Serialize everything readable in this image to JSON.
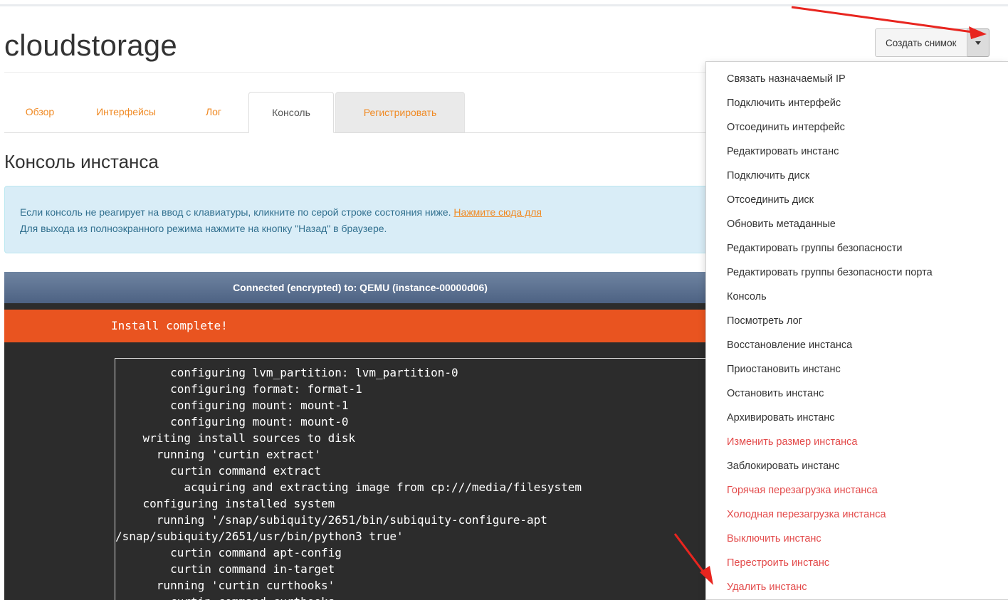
{
  "page": {
    "title": "cloudstorage"
  },
  "actions": {
    "primary_label": "Создать снимок",
    "menu": [
      {
        "label": "Связать назначаемый IP",
        "danger": false
      },
      {
        "label": "Подключить интерфейс",
        "danger": false
      },
      {
        "label": "Отсоединить интерфейс",
        "danger": false
      },
      {
        "label": "Редактировать инстанс",
        "danger": false
      },
      {
        "label": "Подключить диск",
        "danger": false
      },
      {
        "label": "Отсоединить диск",
        "danger": false
      },
      {
        "label": "Обновить метаданные",
        "danger": false
      },
      {
        "label": "Редактировать группы безопасности",
        "danger": false
      },
      {
        "label": "Редактировать группы безопасности порта",
        "danger": false
      },
      {
        "label": "Консоль",
        "danger": false
      },
      {
        "label": "Посмотреть лог",
        "danger": false
      },
      {
        "label": "Восстановление инстанса",
        "danger": false
      },
      {
        "label": "Приостановить инстанс",
        "danger": false
      },
      {
        "label": "Остановить инстанс",
        "danger": false
      },
      {
        "label": "Архивировать инстанс",
        "danger": false
      },
      {
        "label": "Изменить размер инстанса",
        "danger": true
      },
      {
        "label": "Заблокировать инстанс",
        "danger": false
      },
      {
        "label": "Горячая перезагрузка инстанса",
        "danger": true
      },
      {
        "label": "Холодная перезагрузка инстанса",
        "danger": true
      },
      {
        "label": "Выключить инстанс",
        "danger": true
      },
      {
        "label": "Перестроить инстанс",
        "danger": true
      },
      {
        "label": "Удалить инстанс",
        "danger": true
      }
    ]
  },
  "tabs": [
    {
      "label": "Обзор",
      "state": "link"
    },
    {
      "label": "Интерфейсы",
      "state": "link"
    },
    {
      "label": "Лог",
      "state": "link"
    },
    {
      "label": "Консоль",
      "state": "active"
    },
    {
      "label": "Регистрировать",
      "state": "gray"
    }
  ],
  "section": {
    "title": "Консоль инстанса"
  },
  "alert": {
    "line1_text": "Если консоль не реагирует на ввод с клавиатуры, кликните по серой строке состояния ниже.",
    "line1_link": "Нажмите сюда для",
    "line2_text": "Для выхода из полноэкранного режима нажмите на кнопку \"Назад\" в браузере."
  },
  "console": {
    "status": "Connected (encrypted) to: QEMU (instance-00000d06)",
    "banner": "Install complete!",
    "lines": [
      "        configuring lvm_partition: lvm_partition-0",
      "        configuring format: format-1",
      "        configuring mount: mount-1",
      "        configuring mount: mount-0",
      "    writing install sources to disk",
      "      running 'curtin extract'",
      "        curtin command extract",
      "          acquiring and extracting image from cp:///media/filesystem",
      "    configuring installed system",
      "      running '/snap/subiquity/2651/bin/subiquity-configure-apt",
      "/snap/subiquity/2651/usr/bin/python3 true'",
      "        curtin command apt-config",
      "        curtin command in-target",
      "      running 'curtin curthooks'",
      "        curtin command curthooks"
    ]
  },
  "colors": {
    "accent_orange": "#f08a24",
    "danger_red": "#e34b4b",
    "ubuntu_orange": "#e95420",
    "annotation_arrow": "#e8251f"
  }
}
